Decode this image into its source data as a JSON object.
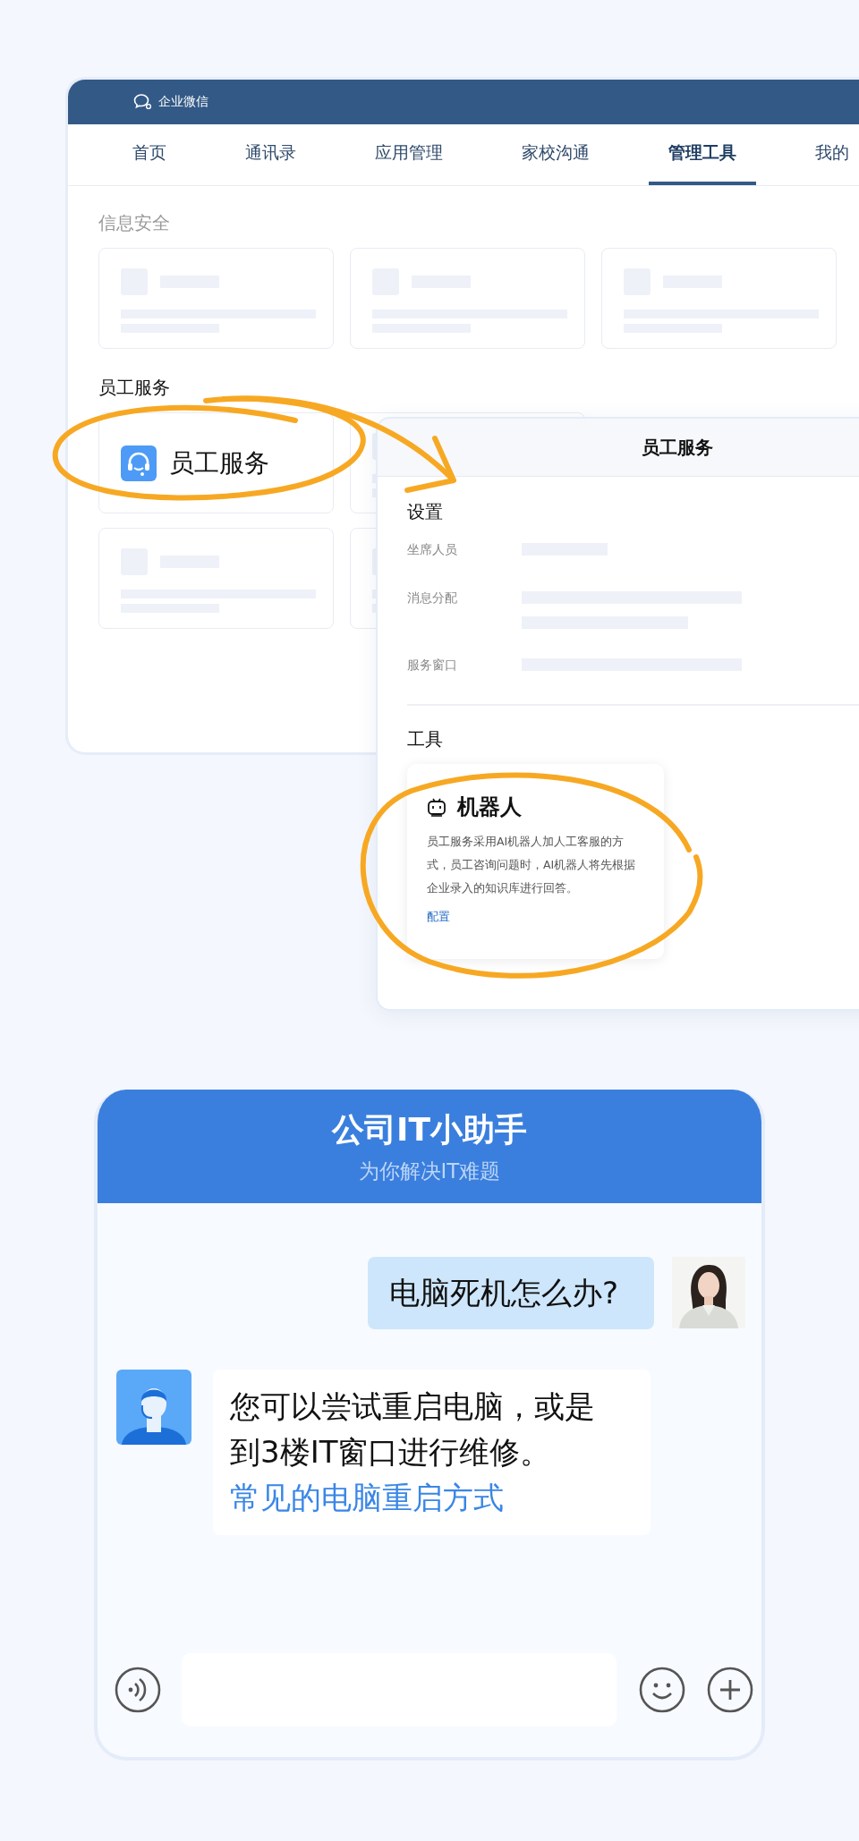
{
  "admin_window": {
    "brand": "企业微信",
    "tabs": [
      {
        "label": "首页",
        "selected": false
      },
      {
        "label": "通讯录",
        "selected": false
      },
      {
        "label": "应用管理",
        "selected": false
      },
      {
        "label": "家校沟通",
        "selected": false
      },
      {
        "label": "管理工具",
        "selected": true
      },
      {
        "label": "我的",
        "selected": false
      }
    ],
    "sections": [
      {
        "title": "信息安全",
        "kind": "muted",
        "cards": [
          {
            "kind": "placeholder"
          },
          {
            "kind": "placeholder"
          },
          {
            "kind": "placeholder"
          }
        ]
      },
      {
        "title": "员工服务",
        "kind": "strong",
        "cards": [
          {
            "kind": "service",
            "label": "员工服务"
          },
          {
            "kind": "placeholder"
          },
          {
            "kind": "placeholder"
          },
          {
            "kind": "placeholder"
          }
        ]
      }
    ]
  },
  "popup": {
    "title": "员工服务",
    "settings_title": "设置",
    "settings": [
      {
        "label": "坐席人员",
        "kind": "short"
      },
      {
        "label": "消息分配",
        "kind": "double"
      },
      {
        "label": "服务窗口",
        "kind": "long"
      }
    ],
    "tools_title": "工具",
    "tool": {
      "title": "机器人",
      "description": "员工服务采用AI机器人加人工客服的方式，员工咨询问题时，AI机器人将先根据企业录入的知识库进行回答。",
      "link": "配置"
    }
  },
  "chat": {
    "title": "公司IT小助手",
    "subtitle": "为你解决IT难题",
    "messages": [
      {
        "kind": "outgoing",
        "text": "电脑死机怎么办?"
      },
      {
        "kind": "incoming",
        "text": "您可以尝试重启电脑，或是到3楼IT窗口进行维修。",
        "link": "常见的电脑重启方式"
      }
    ]
  }
}
